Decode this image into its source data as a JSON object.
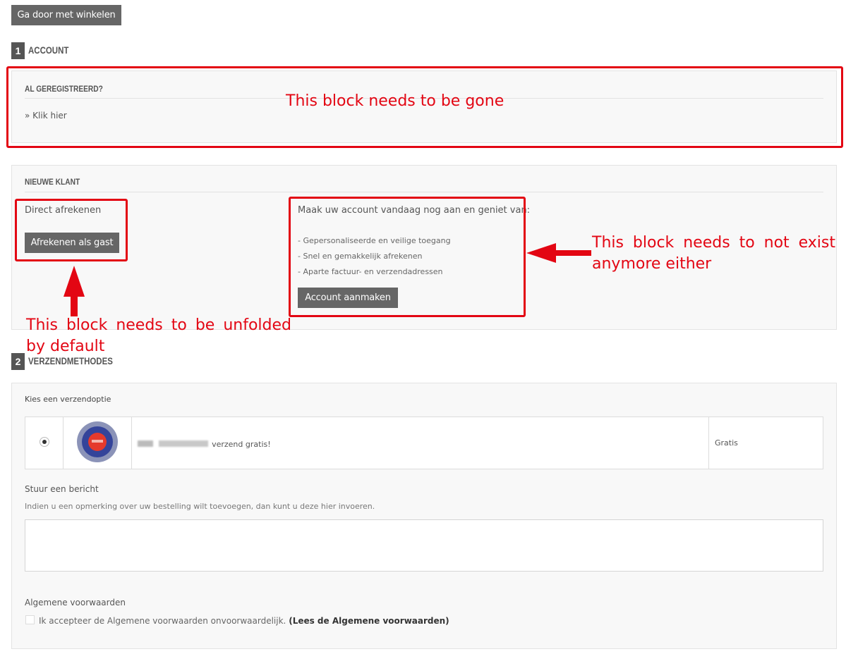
{
  "top": {
    "continue_label": "Ga door met winkelen"
  },
  "steps": [
    {
      "number": "1",
      "title": "ACCOUNT"
    },
    {
      "number": "2",
      "title": "VERZENDMETHODES"
    }
  ],
  "registered": {
    "heading": "AL GEREGISTREERD?",
    "link": "» Klik hier"
  },
  "new_customer": {
    "heading": "NIEUWE KLANT",
    "direct_label": "Direct afrekenen",
    "guest_button": "Afrekenen als gast",
    "create_intro": "Maak uw account vandaag nog aan en geniet van:",
    "benefits": [
      "- Gepersonaliseerde en veilige toegang",
      "- Snel en gemakkelijk afrekenen",
      "- Aparte factuur- en verzendadressen"
    ],
    "create_button": "Account aanmaken"
  },
  "shipping": {
    "choose_label": "Kies een verzendoptie",
    "carrier_suffix": "verzend gratis!",
    "price": "Gratis",
    "message_heading": "Stuur een bericht",
    "message_help": "Indien u een opmerking over uw bestelling wilt toevoegen, dan kunt u deze hier invoeren.",
    "message_value": "",
    "terms_heading": "Algemene voorwaarden",
    "terms_text": "Ik accepteer de Algemene voorwaarden onvoorwaardelijk.",
    "terms_link": "(Lees de Algemene voorwaarden)"
  },
  "annotations": {
    "gone": "This block needs to be gone",
    "not_exist_1": "This block needs to not exist",
    "not_exist_2": "anymore either",
    "unfold_1": "This block needs to be unfolded",
    "unfold_2": "by default"
  },
  "colors": {
    "annotation_red": "#e30613",
    "button_gray": "#666666",
    "panel_bg": "#f8f8f8"
  }
}
